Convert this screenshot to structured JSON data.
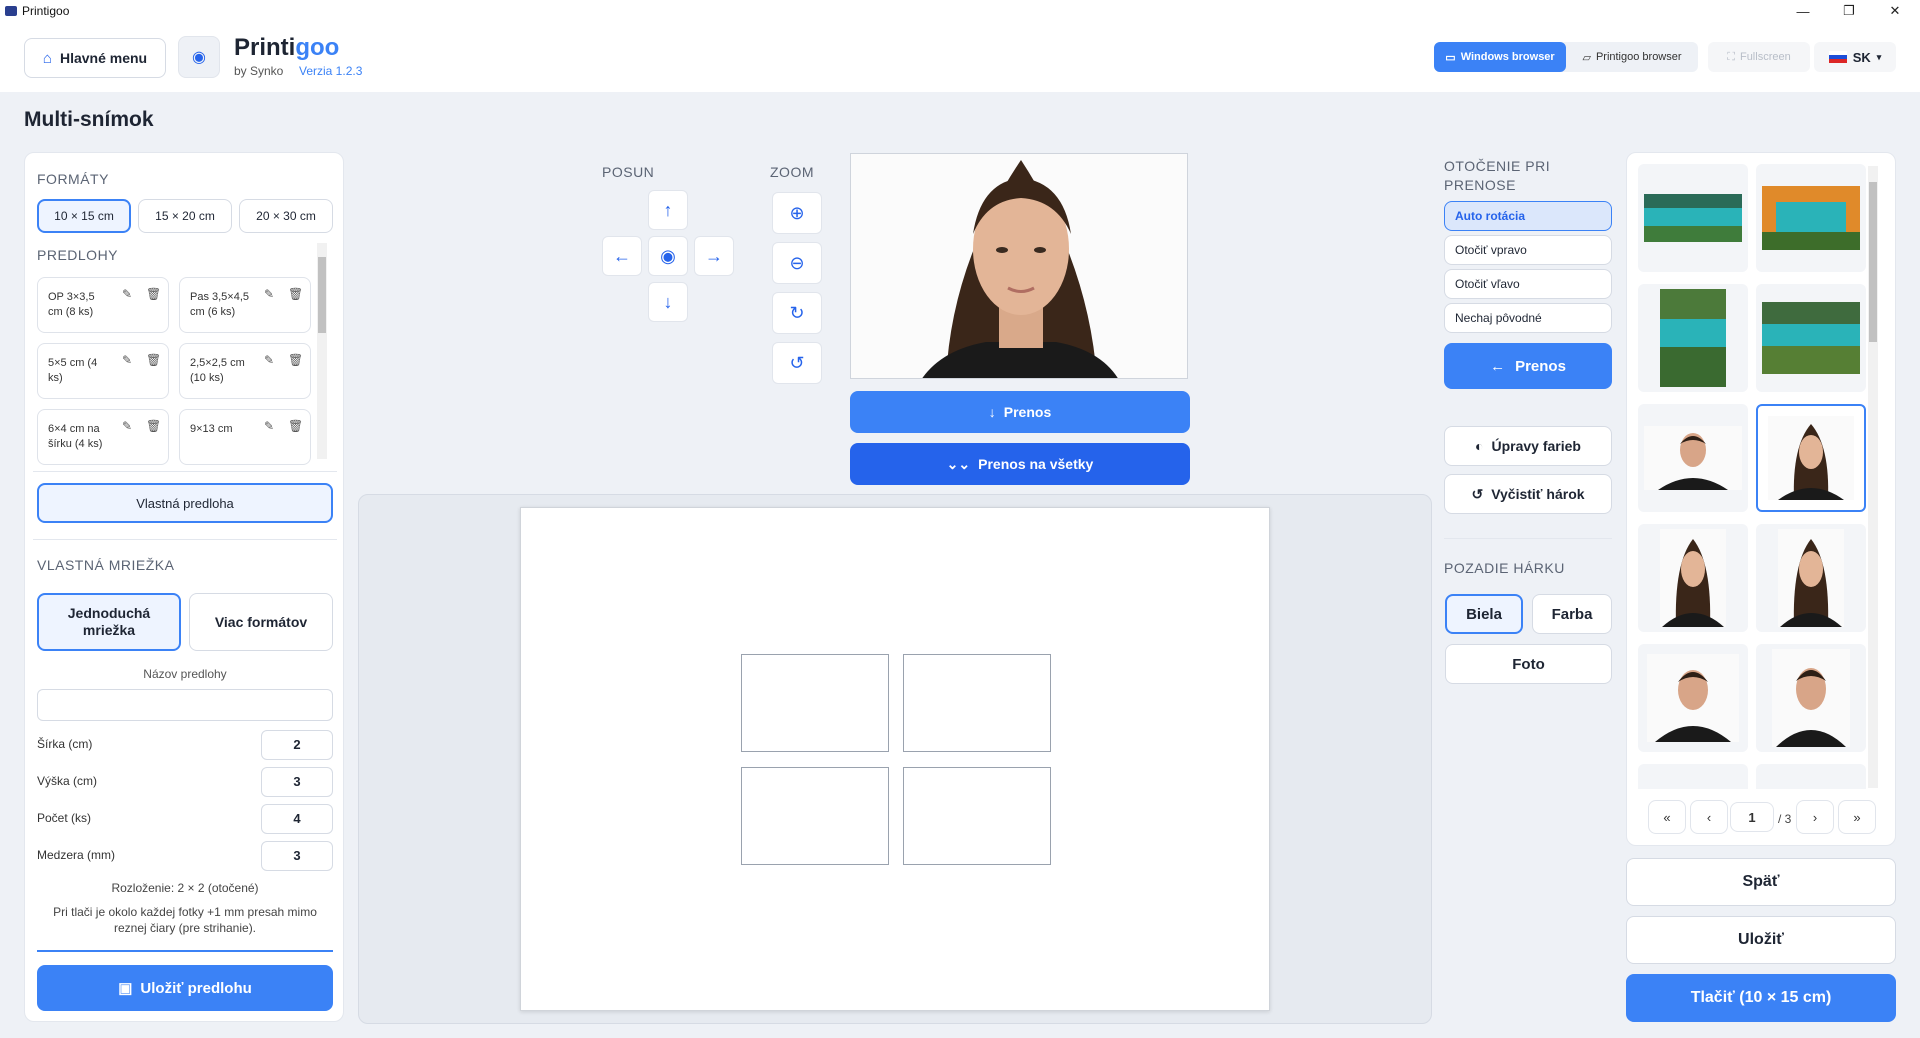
{
  "window": {
    "title": "Printigoo",
    "minimize": "—",
    "restore": "❐",
    "close": "✕"
  },
  "header": {
    "main_menu": "Hlavné menu",
    "brand_a": "Printi",
    "brand_b": "goo",
    "by": "by Synko",
    "version": "Verzia 1.2.3",
    "windows_browser": "Windows browser",
    "printigoo_browser": "Printigoo browser",
    "fullscreen": "Fullscreen",
    "lang": "SK"
  },
  "page_title": "Multi-snímok",
  "left": {
    "formats_title": "FORMÁTY",
    "formats": [
      "10 × 15 cm",
      "15 × 20 cm",
      "20 × 30 cm"
    ],
    "templates_title": "PREDLOHY",
    "templates": [
      {
        "l1": "OP 3×3,5",
        "l2": "cm (8 ks)"
      },
      {
        "l1": "Pas 3,5×4,5",
        "l2": "cm (6 ks)"
      },
      {
        "l1": "5×5 cm (4",
        "l2": "ks)"
      },
      {
        "l1": "2,5×2,5 cm",
        "l2": "(10 ks)"
      },
      {
        "l1": "6×4 cm na",
        "l2": "šírku (4 ks)"
      },
      {
        "l1": "9×13 cm",
        "l2": ""
      }
    ],
    "custom_template": "Vlastná predloha",
    "grid_title": "VLASTNÁ MRIEŽKA",
    "grid_simple": "Jednoduchá mriežka",
    "grid_multi": "Viac formátov",
    "name_label": "Názov predlohy",
    "name_value": "",
    "fields": [
      {
        "label": "Šírka (cm)",
        "value": "2"
      },
      {
        "label": "Výška (cm)",
        "value": "3"
      },
      {
        "label": "Počet (ks)",
        "value": "4"
      },
      {
        "label": "Medzera (mm)",
        "value": "3"
      }
    ],
    "layout_note": "Rozloženie: 2 × 2 (otočené)",
    "bleed_note_1": "Pri tlači je okolo každej fotky +1 mm presah mimo",
    "bleed_note_2": "reznej čiary (pre strihanie).",
    "save_template": "Uložiť predlohu"
  },
  "center": {
    "posun": "POSUN",
    "zoom": "ZOOM",
    "transfer": "Prenos",
    "transfer_all": "Prenos na všetky"
  },
  "right": {
    "rotation_title_1": "OTOČENIE PRI",
    "rotation_title_2": "PRENOSE",
    "rotations": [
      "Auto rotácia",
      "Otočiť vpravo",
      "Otočiť vľavo",
      "Nechaj pôvodné"
    ],
    "transfer_back": "Prenos",
    "color_edit": "Úpravy farieb",
    "clear_sheet": "Vyčistiť hárok",
    "bg_title": "POZADIE HÁRKU",
    "bg_white": "Biela",
    "bg_color": "Farba",
    "bg_photo": "Foto"
  },
  "gallery": {
    "first": "«",
    "prev": "‹",
    "page": "1",
    "total": "/ 3",
    "next": "›",
    "last": "»"
  },
  "actions": {
    "back": "Späť",
    "save": "Uložiť",
    "print": "Tlačiť (10 × 15 cm)"
  },
  "colors": {
    "accent": "#3b82f6",
    "accent_dark": "#2563eb"
  }
}
